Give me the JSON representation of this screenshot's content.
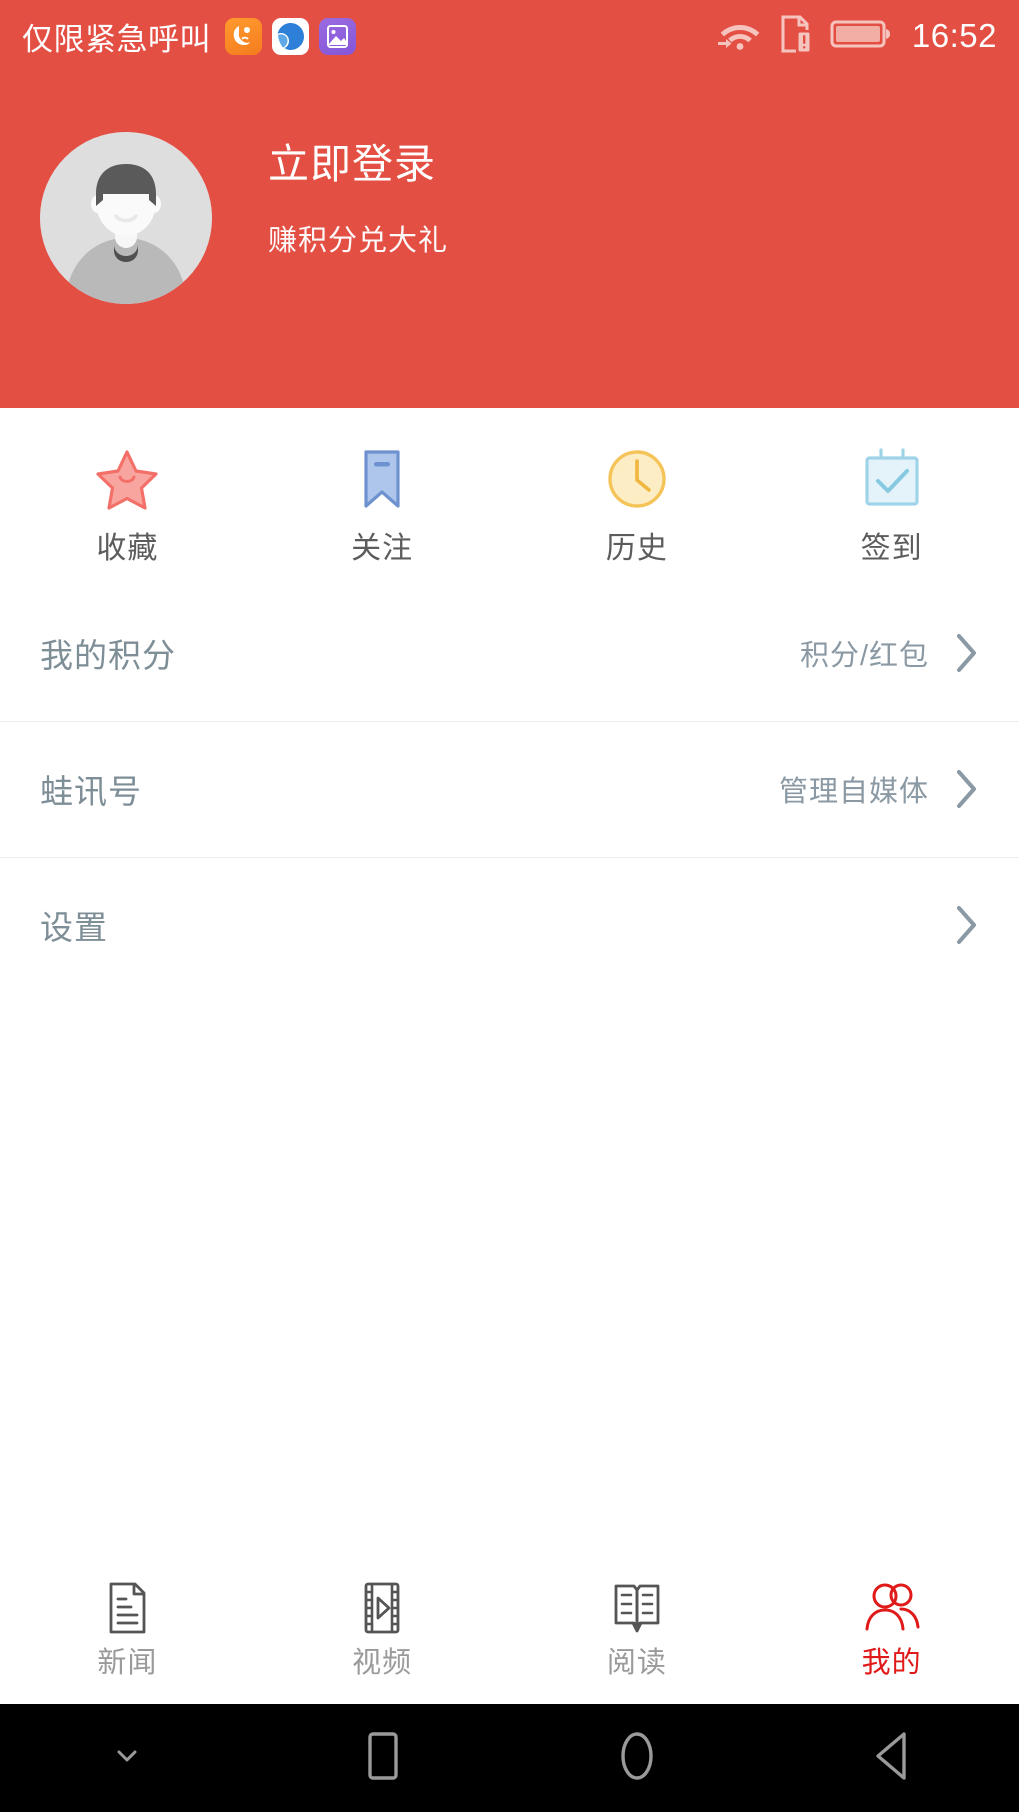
{
  "status_bar": {
    "carrier_text": "仅限紧急呼叫",
    "time": "16:52",
    "app_icons": [
      {
        "name": "uc-browser-icon"
      },
      {
        "name": "qq-browser-icon"
      },
      {
        "name": "gallery-icon"
      }
    ],
    "system_icons": [
      {
        "name": "wifi-icon"
      },
      {
        "name": "sim-alert-icon"
      },
      {
        "name": "battery-icon"
      }
    ]
  },
  "header": {
    "login_title": "立即登录",
    "login_subtitle": "赚积分兑大礼",
    "background_color": "#E44F44",
    "avatar_name": "default-avatar"
  },
  "quick_actions": [
    {
      "label": "收藏",
      "icon": "star-icon",
      "color": "#F48080"
    },
    {
      "label": "关注",
      "icon": "bookmark-icon",
      "color": "#7B9FDC"
    },
    {
      "label": "历史",
      "icon": "clock-icon",
      "color": "#F5C459"
    },
    {
      "label": "签到",
      "icon": "calendar-check-icon",
      "color": "#A8D8E8"
    }
  ],
  "menu_rows": [
    {
      "label": "我的积分",
      "value": "积分/红包"
    },
    {
      "label": "蛙讯号",
      "value": "管理自媒体"
    },
    {
      "label": "设置",
      "value": ""
    }
  ],
  "tabs": [
    {
      "label": "新闻",
      "icon": "news-document-icon",
      "active": false
    },
    {
      "label": "视频",
      "icon": "video-film-icon",
      "active": false
    },
    {
      "label": "阅读",
      "icon": "book-open-icon",
      "active": false
    },
    {
      "label": "我的",
      "icon": "user-group-icon",
      "active": true
    }
  ],
  "nav_bar": [
    {
      "name": "hide-keyboard-button",
      "icon": "chevron-down-icon"
    },
    {
      "name": "recents-button",
      "icon": "square-icon"
    },
    {
      "name": "home-button",
      "icon": "circle-icon"
    },
    {
      "name": "back-button",
      "icon": "triangle-left-icon"
    }
  ],
  "colors": {
    "brand_red": "#E44F44",
    "active_red": "#E01919",
    "menu_label": "#7E8E97",
    "menu_value": "#8A99A3"
  }
}
